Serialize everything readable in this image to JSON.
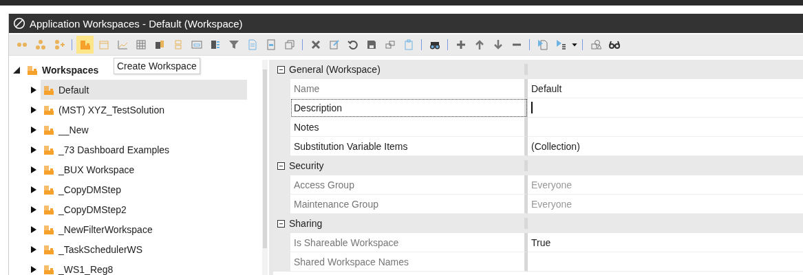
{
  "window": {
    "title": "Application Workspaces - Default (Workspace)"
  },
  "toolbar": {
    "groups": [
      {
        "buttons": [
          {
            "highlighted": false
          },
          {
            "highlighted": false
          },
          {
            "highlighted": false
          }
        ]
      },
      {
        "buttons": [
          {
            "highlighted": true
          },
          {
            "highlighted": false
          },
          {
            "highlighted": false
          },
          {
            "highlighted": false
          },
          {
            "highlighted": false
          },
          {
            "highlighted": false
          },
          {
            "highlighted": false
          },
          {
            "highlighted": false
          },
          {
            "highlighted": false
          },
          {
            "highlighted": false
          },
          {
            "highlighted": false
          },
          {
            "highlighted": false
          }
        ]
      },
      {
        "buttons": [
          {
            "highlighted": false
          },
          {
            "highlighted": false
          },
          {
            "highlighted": false
          },
          {
            "highlighted": false
          },
          {
            "highlighted": false
          },
          {
            "highlighted": false
          }
        ]
      },
      {
        "buttons": [
          {
            "highlighted": false
          }
        ]
      },
      {
        "buttons": [
          {
            "highlighted": false
          },
          {
            "highlighted": false
          },
          {
            "highlighted": false
          },
          {
            "highlighted": false
          }
        ]
      },
      {
        "buttons": [
          {
            "highlighted": false
          },
          {
            "highlighted": false
          }
        ]
      },
      {
        "buttons": [
          {
            "highlighted": false
          },
          {
            "highlighted": false
          }
        ]
      }
    ]
  },
  "tooltip": "Create Workspace",
  "tree": {
    "label": "Workspaces",
    "expanded": true,
    "children": [
      {
        "label": "Default",
        "selected": true,
        "expanded": false
      },
      {
        "label": "(MST) XYZ_TestSolution",
        "selected": false,
        "expanded": false
      },
      {
        "label": "__New",
        "selected": false,
        "expanded": false
      },
      {
        "label": "_73 Dashboard Examples",
        "selected": false,
        "expanded": false
      },
      {
        "label": "_BUX Workspace",
        "selected": false,
        "expanded": false
      },
      {
        "label": "_CopyDMStep",
        "selected": false,
        "expanded": false
      },
      {
        "label": "_CopyDMStep2",
        "selected": false,
        "expanded": false
      },
      {
        "label": "_NewFilterWorkspace",
        "selected": false,
        "expanded": false
      },
      {
        "label": "_TaskSchedulerWS",
        "selected": false,
        "expanded": false
      },
      {
        "label": "_WS1_Reg8",
        "selected": false,
        "expanded": false
      }
    ]
  },
  "properties": [
    {
      "category": "General (Workspace)",
      "expanded": true,
      "rows": [
        {
          "name": "Name",
          "value": "Default",
          "readonly": true,
          "focused": false
        },
        {
          "name": "Description",
          "value": "",
          "readonly": false,
          "focused": true
        },
        {
          "name": "Notes",
          "value": "",
          "readonly": false,
          "focused": false
        },
        {
          "name": "Substitution Variable Items",
          "value": "(Collection)",
          "readonly": false,
          "focused": false
        }
      ]
    },
    {
      "category": "Security",
      "expanded": true,
      "rows": [
        {
          "name": "Access Group",
          "value": "Everyone",
          "readonly": true,
          "focused": false
        },
        {
          "name": "Maintenance Group",
          "value": "Everyone",
          "readonly": true,
          "focused": false
        }
      ]
    },
    {
      "category": "Sharing",
      "expanded": true,
      "rows": [
        {
          "name": "Is Shareable Workspace",
          "value": "True",
          "readonly": true,
          "focused": false
        },
        {
          "name": "Shared Workspace Names",
          "value": "",
          "readonly": true,
          "focused": false
        }
      ]
    }
  ]
}
